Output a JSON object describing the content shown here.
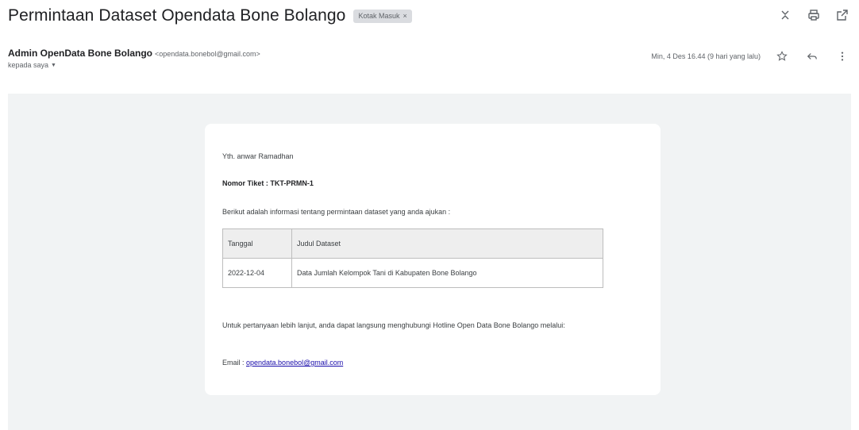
{
  "subject": "Permintaan Dataset Opendata Bone Bolango",
  "label_chip": "Kotak Masuk",
  "label_chip_close": "×",
  "sender": {
    "name": "Admin OpenData Bone Bolango",
    "email": "<opendata.bonebol@gmail.com>",
    "to": "kepada saya",
    "date": "Min, 4 Des 16.44 (9 hari yang lalu)"
  },
  "icons": {
    "expand": "unfold-icon",
    "print": "print-icon",
    "popout": "open-in-new-icon",
    "star": "star-icon",
    "reply": "reply-icon",
    "more": "more-vert-icon"
  },
  "body": {
    "greeting": "Yth. anwar Ramadhan",
    "ticket": "Nomor Tiket : TKT-PRMN-1",
    "intro": "Berikut adalah informasi tentang permintaan dataset yang anda ajukan :",
    "table": {
      "headers": [
        "Tanggal",
        "Judul Dataset"
      ],
      "rows": [
        [
          "2022-12-04",
          "Data Jumlah Kelompok Tani di Kabupaten Bone Bolango"
        ]
      ]
    },
    "closing": "Untuk pertanyaan lebih lanjut, anda dapat langsung menghubungi Hotline Open Data Bone Bolango melalui:",
    "email_label": "Email : ",
    "email_link": "opendata.bonebol@gmail.com"
  }
}
